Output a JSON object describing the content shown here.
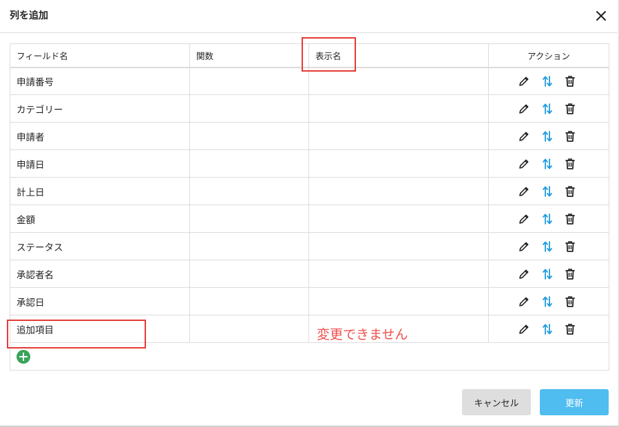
{
  "dialog": {
    "title": "列を追加"
  },
  "table": {
    "headers": {
      "field_name": "フィールド名",
      "function": "関数",
      "display_name": "表示名",
      "action": "アクション"
    },
    "rows": [
      {
        "field": "申請番号",
        "function": "",
        "display": ""
      },
      {
        "field": "カテゴリー",
        "function": "",
        "display": ""
      },
      {
        "field": "申請者",
        "function": "",
        "display": ""
      },
      {
        "field": "申請日",
        "function": "",
        "display": ""
      },
      {
        "field": "計上日",
        "function": "",
        "display": ""
      },
      {
        "field": "金額",
        "function": "",
        "display": ""
      },
      {
        "field": "ステータス",
        "function": "",
        "display": ""
      },
      {
        "field": "承認者名",
        "function": "",
        "display": ""
      },
      {
        "field": "承認日",
        "function": "",
        "display": ""
      },
      {
        "field": "追加項目",
        "function": "",
        "display": ""
      }
    ]
  },
  "annotation": {
    "note": "変更できません",
    "color": "#e53935"
  },
  "footer": {
    "cancel_label": "キャンセル",
    "update_label": "更新"
  },
  "colors": {
    "accent": "#4fbdf0",
    "add": "#3aa35a",
    "sort_arrow": "#1e9be0"
  }
}
